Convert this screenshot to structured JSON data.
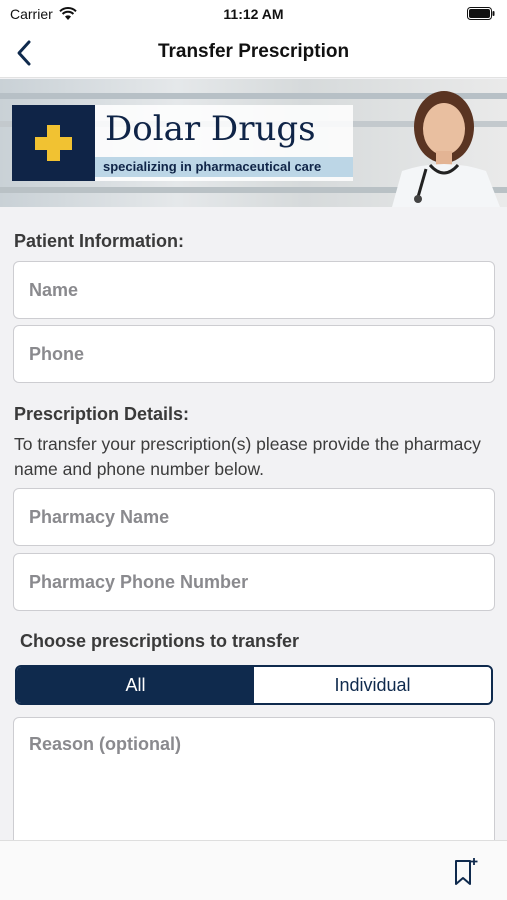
{
  "status_bar": {
    "carrier": "Carrier",
    "time": "11:12 AM"
  },
  "nav": {
    "title": "Transfer Prescription",
    "back_icon": "chevron-left-icon"
  },
  "banner": {
    "brand_name": "Dolar Drugs",
    "tagline": "specializing in pharmaceutical care",
    "logo_icon": "plus-icon"
  },
  "patient": {
    "heading": "Patient Information:",
    "name_placeholder": "Name",
    "phone_placeholder": "Phone"
  },
  "prescription": {
    "heading": "Prescription Details:",
    "help_text": "To transfer your prescription(s) please provide the pharmacy name and phone number below.",
    "pharmacy_name_placeholder": "Pharmacy Name",
    "pharmacy_phone_placeholder": "Pharmacy Phone Number"
  },
  "transfer_choice": {
    "heading": "Choose prescriptions to transfer",
    "options": [
      "All",
      "Individual"
    ],
    "selected": "All"
  },
  "reason": {
    "placeholder": "Reason (optional)"
  },
  "bottom_bar": {
    "bookmark_icon": "bookmark-add-icon"
  },
  "colors": {
    "navy": "#0f2a4d",
    "accent_gold": "#f1c232",
    "background": "#f2f2f4"
  }
}
